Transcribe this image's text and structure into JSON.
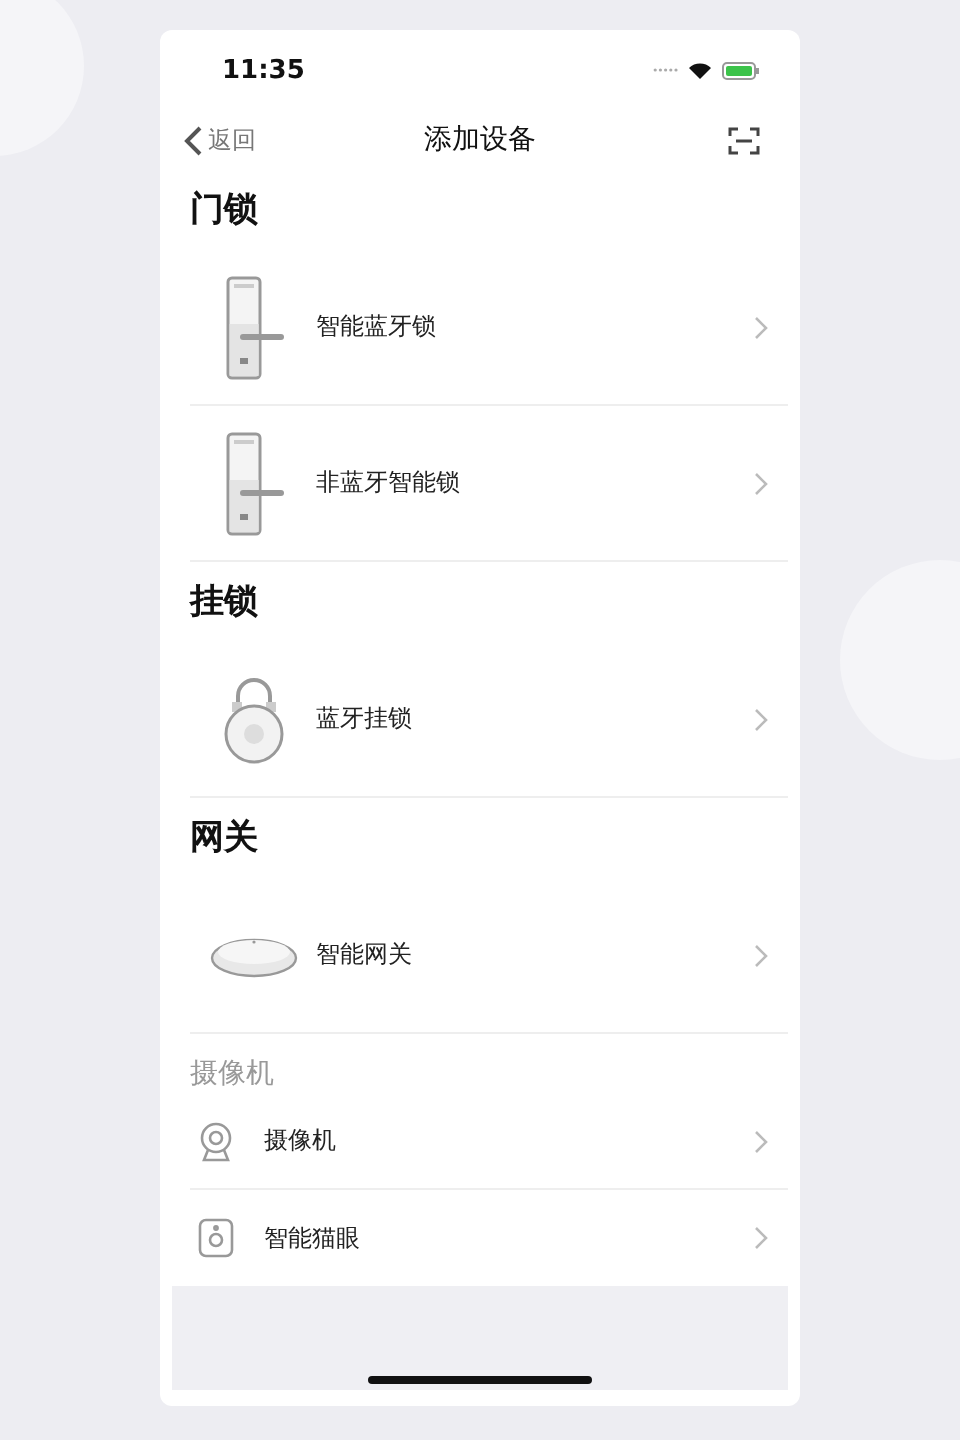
{
  "status_bar": {
    "time": "11:35"
  },
  "nav": {
    "back": "返回",
    "title": "添加设备"
  },
  "sections": [
    {
      "kind": "large",
      "title": "门锁",
      "items": [
        {
          "kind": "door-lock",
          "label": "智能蓝牙锁"
        },
        {
          "kind": "door-lock",
          "label": "非蓝牙智能锁"
        }
      ]
    },
    {
      "kind": "large",
      "title": "挂锁",
      "items": [
        {
          "kind": "padlock",
          "label": "蓝牙挂锁"
        }
      ]
    },
    {
      "kind": "large",
      "title": "网关",
      "items": [
        {
          "kind": "gateway",
          "label": "智能网关"
        }
      ]
    },
    {
      "kind": "small",
      "title": "摄像机",
      "items": [
        {
          "kind": "camera",
          "label": "摄像机"
        },
        {
          "kind": "peephole",
          "label": "智能猫眼"
        }
      ]
    }
  ]
}
